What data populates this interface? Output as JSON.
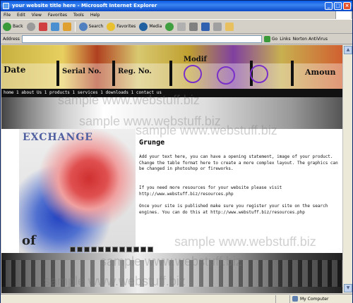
{
  "window": {
    "title": "your website title here - Microsoft Internet Explorer"
  },
  "menu": [
    "File",
    "Edit",
    "View",
    "Favorites",
    "Tools",
    "Help"
  ],
  "toolbar": {
    "back": "Back",
    "search": "Search",
    "favorites": "Favorites",
    "media": "Media"
  },
  "address": {
    "label": "Address",
    "go": "Go",
    "links": "Links",
    "norton": "Norton AntiVirus"
  },
  "status": {
    "zone": "My Computer"
  },
  "banner": {
    "date": "Date",
    "serial": "Serial No.",
    "reg": "Reg. No.",
    "amount": "Amoun",
    "mod": "Modif"
  },
  "nav": {
    "text": "home 1 about Us 1 products 1 services 1 downloads 1 contact us"
  },
  "art": {
    "title": "EXCHANGE",
    "stamp": "of"
  },
  "main": {
    "heading": "Grunge",
    "p1": "Add your text here, you can have a opening statement, image of your product. Change the table format here to create a more complex layout. The graphics can be changed in photoshop or fireworks.",
    "p2": "If you need more resources for your website please visit http://www.webstuff.biz/resources.php",
    "p3": "Once your site is published make sure you register your site on the search engines. You can do this at http://www.webstuff.biz/resources.php"
  },
  "watermark": {
    "text": "sample www.webstuff.biz"
  }
}
